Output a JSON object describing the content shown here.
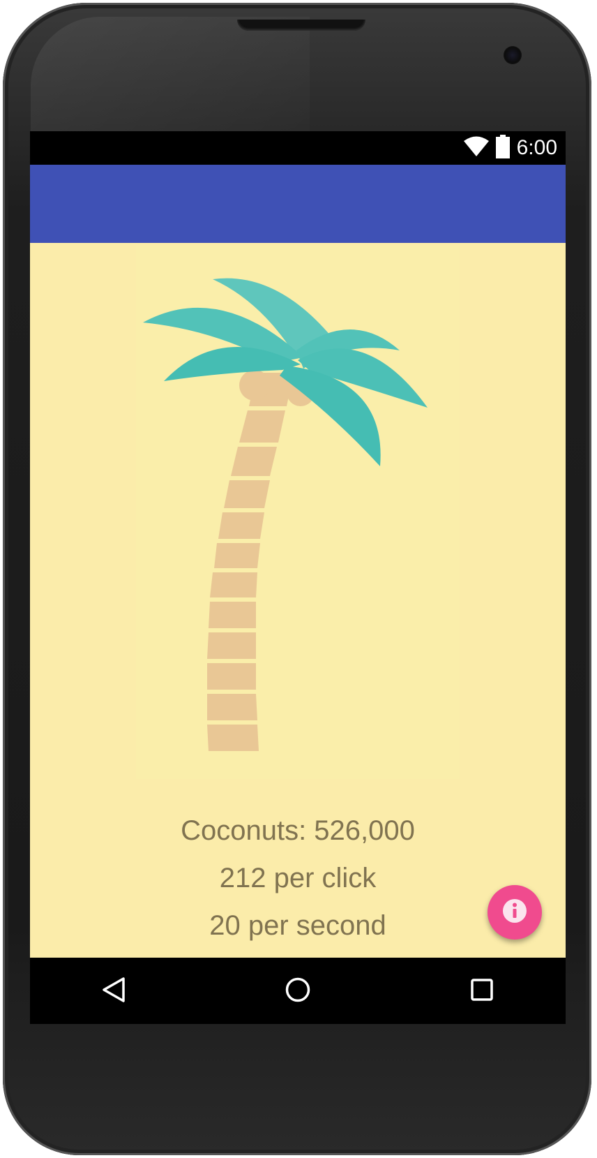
{
  "status_bar": {
    "time": "6:00",
    "icons": [
      "wifi-icon",
      "battery-icon"
    ]
  },
  "app_bar": {
    "color": "#3f51b5"
  },
  "game": {
    "background_color": "#fbecaa",
    "image": "palm-tree",
    "stats": {
      "coconuts": "Coconuts: 526,000",
      "per_click": "212 per click",
      "per_second": "20 per second"
    },
    "fab_icon": "info-icon",
    "fab_color": "#f04b8e"
  },
  "navigation": {
    "buttons": [
      "back-icon",
      "home-icon",
      "recents-icon"
    ]
  }
}
